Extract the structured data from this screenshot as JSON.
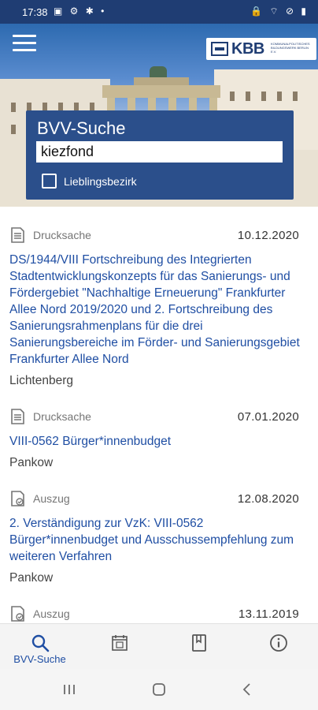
{
  "status_bar": {
    "time": "17:38",
    "left_icons": "▣ ⚙ ✱ •",
    "right_icons": "🔒 ⌔ ⊘ ▮"
  },
  "header": {
    "menu_icon": "hamburger-icon",
    "logo": {
      "text": "KBB",
      "subtitle": "KOMMUNALPOLITISCHES BILDUNGSWERK BERLIN E.V."
    }
  },
  "search": {
    "title": "BVV-Suche",
    "value": "kiezfond",
    "favorite_label": "Lieblingsbezirk",
    "favorite_checked": false
  },
  "results": [
    {
      "type": "Drucksache",
      "icon": "document-icon",
      "date": "10.12.2020",
      "title": "DS/1944/VIII Fortschreibung des Integrierten Stadtentwicklungskonzepts für das Sanierungs- und Fördergebiet \"Nachhaltige Erneuerung\" Frankfurter Allee Nord 2019/2020 und 2. Fortschreibung des Sanierungsrahmenplans für die drei Sanierungsbereiche im Förder- und Sanierungsgebiet Frankfurter Allee Nord",
      "district": "Lichtenberg"
    },
    {
      "type": "Drucksache",
      "icon": "document-icon",
      "date": "07.01.2020",
      "title": "VIII-0562 Bürger*innenbudget",
      "district": "Pankow"
    },
    {
      "type": "Auszug",
      "icon": "excerpt-icon",
      "date": "12.08.2020",
      "title": "2. Verständigung zur VzK: VIII-0562 Bürger*innenbudget und Ausschussempfehlung zum weiteren Verfahren",
      "district": "Pankow"
    },
    {
      "type": "Auszug",
      "icon": "excerpt-icon",
      "date": "13.11.2019",
      "title": "",
      "district": ""
    }
  ],
  "bottom_nav": [
    {
      "label": "BVV-Suche",
      "icon": "search-icon",
      "active": true
    },
    {
      "label": "",
      "icon": "calendar-icon",
      "active": false
    },
    {
      "label": "",
      "icon": "book-icon",
      "active": false
    },
    {
      "label": "",
      "icon": "info-icon",
      "active": false
    }
  ],
  "colors": {
    "primary": "#2b4f8b",
    "link": "#1f4ea3",
    "status_bar": "#1f3d73"
  }
}
